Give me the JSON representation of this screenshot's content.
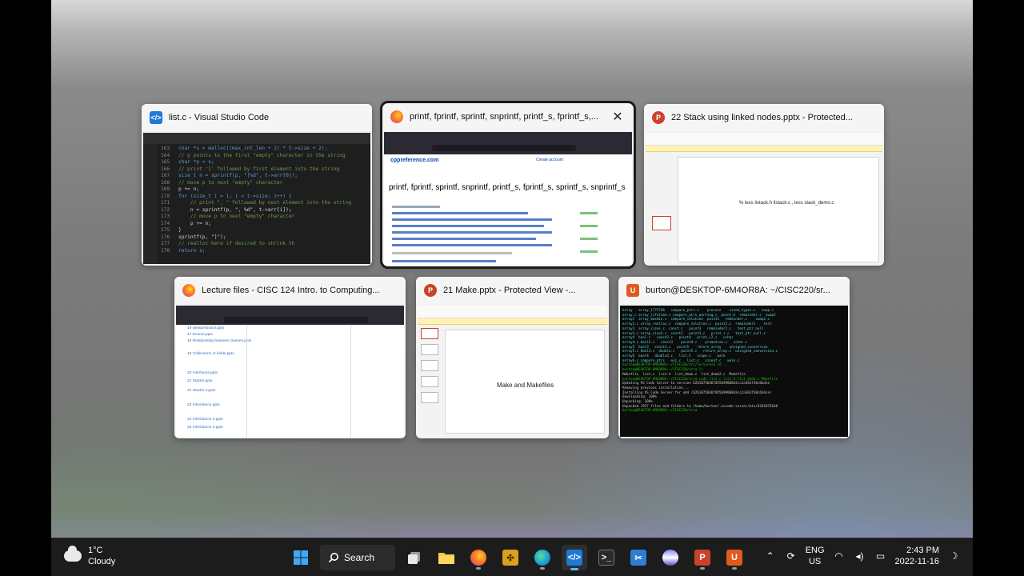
{
  "windows": [
    {
      "app": "vscode",
      "icon": "vscode-icon",
      "title": "list.c - Visual Studio Code"
    },
    {
      "app": "firefox",
      "icon": "firefox-icon",
      "title": "printf, fprintf, sprintf, snprintf, printf_s, fprintf_s,...",
      "close": "✕",
      "site_logo": "cppreference.com",
      "create_account": "Create account",
      "heading": "printf, fprintf, sprintf, snprintf, printf_s, fprintf_s, sprintf_s, snprintf_s"
    },
    {
      "app": "powerpoint",
      "icon": "powerpoint-icon",
      "title": "22 Stack using linked nodes.pptx  - Protected...",
      "slide_text": "% less listack.h listack.c , less stack_demo.c"
    },
    {
      "app": "firefox",
      "icon": "firefox-icon",
      "title": "Lecture files - CISC 124 Intro. to Computing...",
      "rows": [
        "19 isleaderboard.pptx",
        "17 Enums.pptx",
        "18 Relationship between classes.pptx",
        "19 Collections or fields.pptx",
        "20 Interfaces.pptx",
        "21 Stacks.pptx",
        "22 Stacks 2.pptx",
        "23 Inheritance.pptx",
        "24 Inheritance 2.pptx",
        "25 Inheritance 3.pptx"
      ]
    },
    {
      "app": "powerpoint",
      "icon": "powerpoint-icon",
      "title": "21 Make.pptx  - Protected View -...",
      "slide_text": "Make and Makefiles"
    },
    {
      "app": "ubuntu",
      "icon": "ubuntu-icon",
      "title": "burton@DESKTOP-6M4OR8A: ~/CISC220/sr..."
    }
  ],
  "code": {
    "lines": [
      {
        "n": "163",
        "t": "char *s = malloc((max_int_len + 2) * t->size + 2);"
      },
      {
        "n": "164",
        "t": "// p points to the first \"empty\" character in the string"
      },
      {
        "n": "165",
        "t": "char *p = s;"
      },
      {
        "n": "166",
        "t": "// print '[' followed by first element into the string"
      },
      {
        "n": "167",
        "t": "size_t n = sprintf(p, \"[%d\", t->arr[0]);"
      },
      {
        "n": "168",
        "t": "// move p to next \"empty\" character"
      },
      {
        "n": "169",
        "t": "p += n;"
      },
      {
        "n": "170",
        "t": "for (size_t i = 1; i < t->size; i++) {"
      },
      {
        "n": "171",
        "t": "    // print \", \" followed by next element into the string"
      },
      {
        "n": "172",
        "t": "    n = sprintf(p, \", %d\", t->arr[i]);"
      },
      {
        "n": "173",
        "t": "    // move p to next \"empty\" character"
      },
      {
        "n": "174",
        "t": "    p += n;"
      },
      {
        "n": "175",
        "t": "}"
      },
      {
        "n": "176",
        "t": "sprintf(p, \"]\");"
      },
      {
        "n": "177",
        "t": "// realloc here if desired to shrink th"
      },
      {
        "n": "178",
        "t": "return s;"
      }
    ]
  },
  "terminal": {
    "lines": [
      "array   array_1775746   compare_ptrs.c    process    sized_types.c   swap.c",
      "array.c array_lifetime.c compare_ptrs_warning.c  point.h  remainder.c  swap2",
      "array2  array_maxmin.c  compare_solution  point2   remainder.c    swap2.c",
      "array2.c array_realloc.c  compare_solution.c  point2.c  remainder2    test",
      "array3  array_sizes.c  const.c   point3   remainder2.c   test_ptr_null",
      "array3.c array_size2.c  const2   point3.c   print_i.c   text_ptr_null.c",
      "array4  bool.c   const2.c   point4   print_i2.c   vchar",
      "array4.c bool2.c   const3    point4.c    promotion.c   vchar.c",
      "array5  bool3   const3.c   point5    return_array    unsigned_conversion",
      "array5.c bool3.c  double.c   point5.c   return_array.c  unsigned_conversion.c",
      "array6  bool4   double2.c   list.h   scope.c   walk",
      "array6.c compare_ptrs   ex1.c   list.c   sizeof.c   walk.c",
      "burton@DESKTOP-6M4OR8A:~/CISC220/src/lectures$ cd .. ",
      "burton@DESKTOP-6M4OR8A:~/CISC220/src$ ls",
      "Makefile  list.c  list.h  list_demo.c  list_demo2.c  Makefile",
      "burton@DESKTOP-6M4OR8A:~/CISC220/src$ code list.c list.h list_demo.c Makefile",
      "Updating VS Code Server to version 6261075646f055b99068d3cc2a303f38c6b4ce",
      "Removing previous installation...",
      "Installing VS Code Server for x64 (6261075646f055b99068d3cc2a303f38c6b4ce)",
      "Downloading: 100%",
      "Unpacking: 100%",
      "Unpacked 1957 files and folders to /home/burton/.vscode-server/bin/6261075646",
      "burton@DESKTOP-6M4OR8A:~/CISC220/src$ "
    ]
  },
  "taskbar": {
    "weather_temp": "1°C",
    "weather_desc": "Cloudy",
    "search_label": "Search",
    "lang_1": "ENG",
    "lang_2": "US",
    "time": "2:43 PM",
    "date": "2022-11-16"
  }
}
